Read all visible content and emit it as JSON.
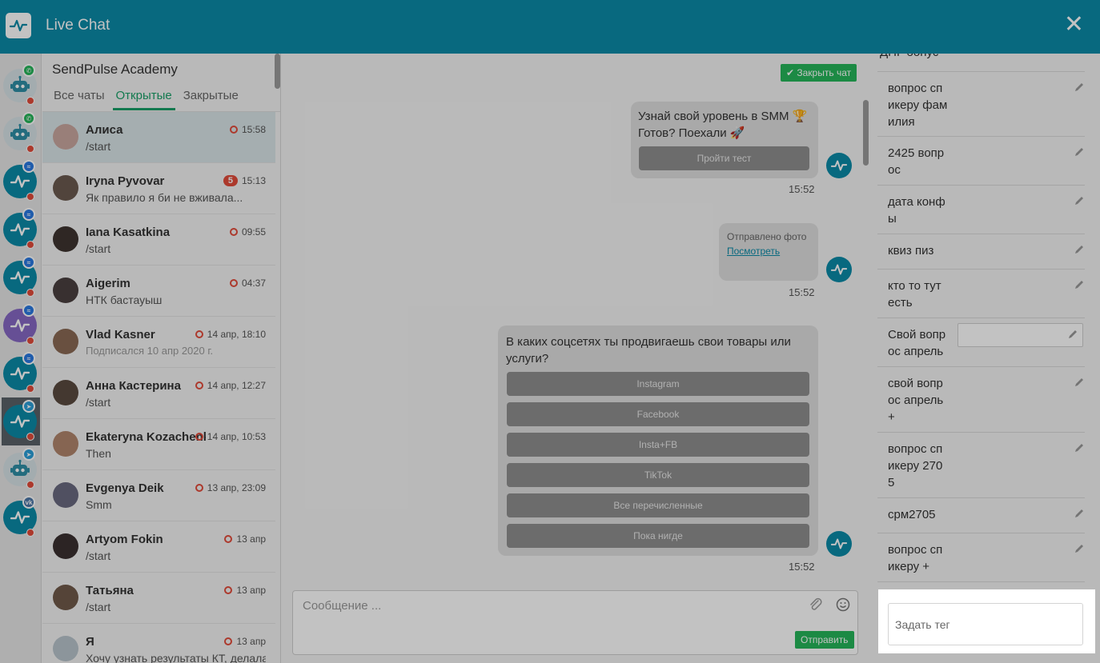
{
  "header": {
    "title": "Live Chat",
    "close_icon": "close-icon",
    "accent": "#0b8aa8"
  },
  "bots": [
    {
      "type": "robot",
      "badge": "whatsapp"
    },
    {
      "type": "robot",
      "badge": "whatsapp"
    },
    {
      "type": "pulse",
      "badge": "messenger"
    },
    {
      "type": "pulse",
      "badge": "messenger"
    },
    {
      "type": "pulse",
      "badge": "messenger"
    },
    {
      "type": "purple",
      "badge": "messenger"
    },
    {
      "type": "pulse",
      "badge": "messenger"
    },
    {
      "type": "pulse",
      "badge": "telegram",
      "active": true
    },
    {
      "type": "robot",
      "badge": "telegram"
    },
    {
      "type": "pulse",
      "badge": "vk"
    }
  ],
  "contacts": {
    "bot_name": "SendPulse Academy",
    "tabs": [
      "Все чаты",
      "Открытые",
      "Закрытые"
    ],
    "active_tab": 1,
    "items": [
      {
        "name": "Алиса",
        "msg": "/start",
        "time": "15:58",
        "ring": true,
        "color": "#c9a8a0"
      },
      {
        "name": "Iryna Pyvovar",
        "msg": "Як правило я би не вживала...",
        "time": "15:13",
        "unread": "5",
        "color": "#6b5a50"
      },
      {
        "name": "Iana Kasatkina",
        "msg": "/start",
        "time": "09:55",
        "ring": true,
        "color": "#3e3430"
      },
      {
        "name": "Aigerim",
        "msg": "НТК бастауыш",
        "time": "04:37",
        "ring": true,
        "color": "#4a4040"
      },
      {
        "name": "Vlad Kasner",
        "msg": "Подписался 10 апр 2020 г.",
        "time": "14 апр, 18:10",
        "ring": true,
        "muted": true,
        "color": "#8a6a55"
      },
      {
        "name": "Анна Кастерина",
        "msg": "/start",
        "time": "14 апр, 12:27",
        "ring": true,
        "color": "#5a4a40"
      },
      {
        "name": "Ekateryna Kozachenko",
        "msg": "Then",
        "time": "14 апр, 10:53",
        "ring": true,
        "color": "#b0856c"
      },
      {
        "name": "Evgenya Deik",
        "msg": "Smm",
        "time": "13 апр, 23:09",
        "ring": true,
        "color": "#6a6a80"
      },
      {
        "name": "Artyom Fokin",
        "msg": "/start",
        "time": "13 апр",
        "ring": true,
        "color": "#3a3030"
      },
      {
        "name": "Татьяна",
        "msg": "/start",
        "time": "13 апр",
        "ring": true,
        "color": "#705a4a"
      },
      {
        "name": "Я",
        "msg": "Хочу узнать результаты КТ, делала...",
        "time": "13 апр",
        "ring": true,
        "color": "#b8c4cc"
      }
    ]
  },
  "chat": {
    "close_chat_label": "✔ Закрыть чат",
    "msg1_line1": "Узнай свой уровень в SMM 🏆",
    "msg1_line2": "Готов? Поехали 🚀",
    "msg1_button": "Пройти тест",
    "msg1_time": "15:52",
    "msg2_label": "Отправлено фото",
    "msg2_link": "Посмотреть",
    "msg2_time": "15:52",
    "msg3_line1": "В каких соцсетях ты продвигаешь свои товары или",
    "msg3_line2": "услуги?",
    "msg3_buttons": [
      "Instagram",
      "Facebook",
      "Insta+FB",
      "TikTok",
      "Все перечисленные",
      "Пока нигде"
    ],
    "msg3_time": "15:52",
    "composer_placeholder": "Сообщение ...",
    "send_label": "Отправить"
  },
  "tags": {
    "top_partial": "ДНГ бонус",
    "rows": [
      {
        "lines": [
          "вопрос сп",
          "икеру фам",
          "илия"
        ]
      },
      {
        "lines": [
          "2425 вопр",
          "ос"
        ]
      },
      {
        "lines": [
          "дата конф",
          "ы"
        ]
      },
      {
        "lines": [
          "квиз пиз"
        ]
      },
      {
        "lines": [
          "кто то тут",
          "есть"
        ]
      },
      {
        "lines": [
          "Свой вопр",
          "ос апрель"
        ],
        "input": true
      },
      {
        "lines": [
          "свой вопр",
          "ос апрель",
          "+"
        ]
      },
      {
        "lines": [
          "вопрос сп",
          "икеру 270",
          "5"
        ]
      },
      {
        "lines": [
          "срм2705"
        ]
      },
      {
        "lines": [
          "вопрос сп",
          "икеру +"
        ]
      }
    ],
    "add_tag_placeholder": "Задать тег"
  }
}
